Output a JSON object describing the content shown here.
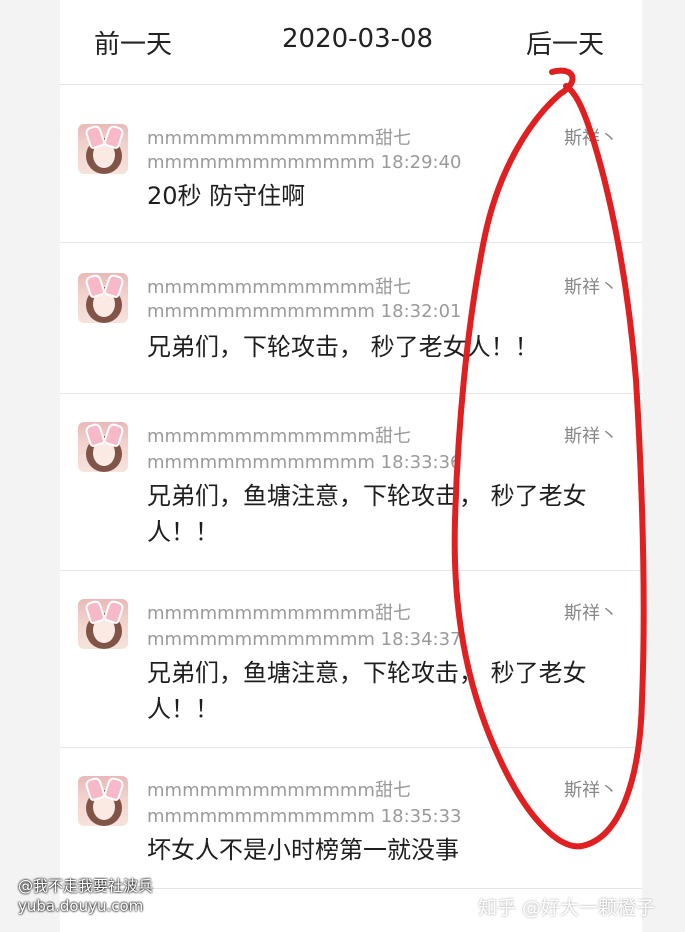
{
  "header": {
    "prev_label": "前一天",
    "date": "2020-03-08",
    "next_label": "后一天"
  },
  "messages": [
    {
      "name": "mmmmmmmmmmmmm甜七",
      "meta": "mmmmmmmmmmmmm 18:29:40",
      "sender": "斯祥丶",
      "text": "20秒 防守住啊"
    },
    {
      "name": "mmmmmmmmmmmmm甜七",
      "meta": "mmmmmmmmmmmmm 18:32:01",
      "sender": "斯祥丶",
      "text": "兄弟们，下轮攻击， 秒了老女人！！"
    },
    {
      "name": "mmmmmmmmmmmmm甜七",
      "meta": "mmmmmmmmmmmmm 18:33:36",
      "sender": "斯祥丶",
      "text": "兄弟们，鱼塘注意，下轮攻击， 秒了老女人！！"
    },
    {
      "name": "mmmmmmmmmmmmm甜七",
      "meta": "mmmmmmmmmmmmm 18:34:37",
      "sender": "斯祥丶",
      "text": "兄弟们，鱼塘注意，下轮攻击， 秒了老女人！！"
    },
    {
      "name": "mmmmmmmmmmmmm甜七",
      "meta": "mmmmmmmmmmmmm 18:35:33",
      "sender": "斯祥丶",
      "text": "坏女人不是小时榜第一就没事"
    }
  ],
  "watermark": {
    "left_line1": "@我不走我要社波兵",
    "left_line2": "yuba.douyu.com",
    "right": "知乎 @好大一颗橙子"
  },
  "annotation_color": "#e02020"
}
